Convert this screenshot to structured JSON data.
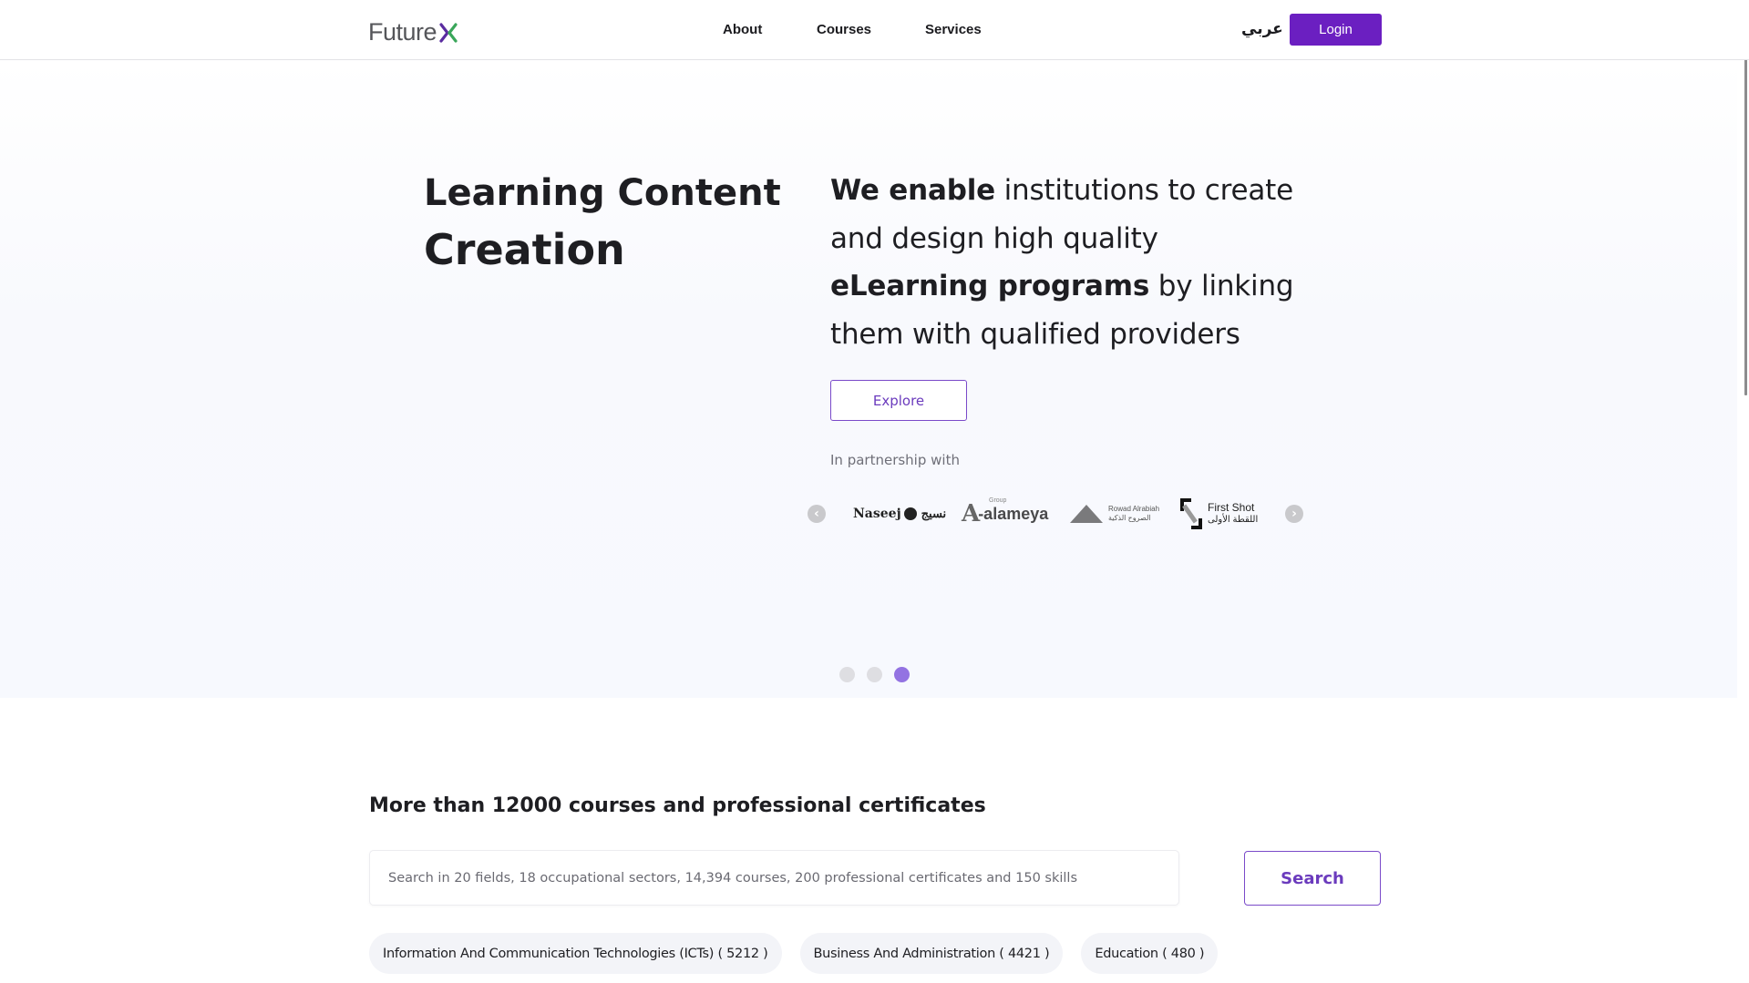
{
  "header": {
    "logo_text": "Future",
    "logo_mark": "X",
    "nav": [
      {
        "label": "About"
      },
      {
        "label": "Courses"
      },
      {
        "label": "Services"
      }
    ],
    "language_toggle": "عربي",
    "login_label": "Login"
  },
  "hero": {
    "title_line1": "Learning Content",
    "title_line2": "Creation",
    "description": {
      "bold1": "We enable",
      "text1": " institutions to create and design high quality ",
      "bold2": "eLearning programs",
      "text2": " by linking them with qualified providers"
    },
    "explore_label": "Explore",
    "partnership_label": "In partnership with",
    "partners": [
      {
        "name": "Naseej",
        "arabic": "نسيج"
      },
      {
        "name": "Al-alameya",
        "subtitle": "Group"
      },
      {
        "name": "Rowad Alrabiah",
        "arabic": "الصروح الذكية"
      },
      {
        "name": "First Shot",
        "arabic": "اللقطة الأولى"
      }
    ],
    "carousel_prev_icon": "chevron-left-icon",
    "carousel_next_icon": "chevron-right-icon",
    "slides_total": 3,
    "active_slide": 3
  },
  "courses": {
    "title_prefix": "More than ",
    "title_count": "12000",
    "title_suffix": " courses and professional certificates",
    "search_placeholder": "Search in 20 fields, 18 occupational sectors, 14,394 courses, 200 professional certificates and 150 skills",
    "search_value": "",
    "search_label": "Search",
    "categories": [
      {
        "label": "Information And Communication Technologies (ICTs) ( 5212 )"
      },
      {
        "label": "Business And Administration ( 4421 )"
      },
      {
        "label": "Education ( 480 )"
      }
    ]
  },
  "colors": {
    "brand_purple": "#6b1fc1",
    "outline_purple": "#7a4ac9",
    "active_dot": "#9373e2",
    "logo_green": "#3aa65a"
  }
}
